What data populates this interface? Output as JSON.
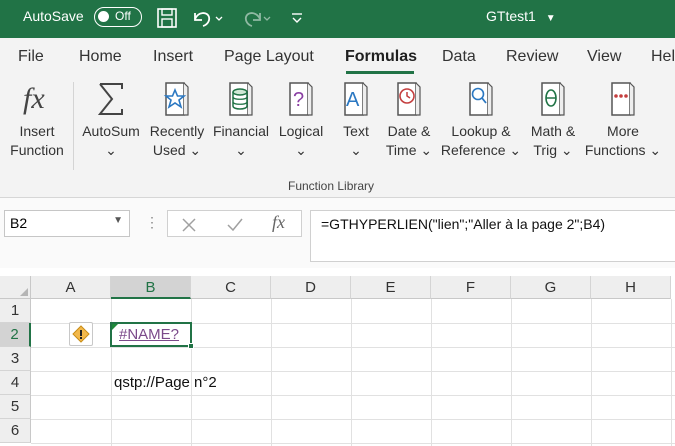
{
  "titlebar": {
    "autosave_label": "AutoSave",
    "autosave_state": "Off",
    "doc_title": "GTtest1"
  },
  "tabs": [
    {
      "label": "File"
    },
    {
      "label": "Home"
    },
    {
      "label": "Insert"
    },
    {
      "label": "Page Layout"
    },
    {
      "label": "Formulas",
      "active": true
    },
    {
      "label": "Data"
    },
    {
      "label": "Review"
    },
    {
      "label": "View"
    },
    {
      "label": "Hel"
    }
  ],
  "ribbon": {
    "group_label": "Function Library",
    "buttons": {
      "insert_function": {
        "line1": "Insert",
        "line2": "Function"
      },
      "autosum": {
        "line1": "AutoSum",
        "line2": "⌄"
      },
      "recently_used": {
        "line1": "Recently",
        "line2": "Used ⌄"
      },
      "financial": {
        "line1": "Financial",
        "line2": "⌄"
      },
      "logical": {
        "line1": "Logical",
        "line2": "⌄"
      },
      "text": {
        "line1": "Text",
        "line2": "⌄"
      },
      "date_time": {
        "line1": "Date &",
        "line2": "Time ⌄"
      },
      "lookup": {
        "line1": "Lookup &",
        "line2": "Reference ⌄"
      },
      "math": {
        "line1": "Math &",
        "line2": "Trig ⌄"
      },
      "more": {
        "line1": "More",
        "line2": "Functions ⌄"
      }
    }
  },
  "formula_bar": {
    "name_box": "B2",
    "formula": "=GTHYPERLIEN(\"lien\";\"Aller à la page 2\";B4)",
    "fx": "fx"
  },
  "grid": {
    "columns": [
      "A",
      "B",
      "C",
      "D",
      "E",
      "F",
      "G",
      "H"
    ],
    "rows": [
      "1",
      "2",
      "3",
      "4",
      "5",
      "6"
    ],
    "cells": {
      "B2": "#NAME?",
      "B4": "qstp://Page n°2"
    }
  },
  "colors": {
    "accent": "#217346",
    "error_text": "#7b4a8a"
  }
}
